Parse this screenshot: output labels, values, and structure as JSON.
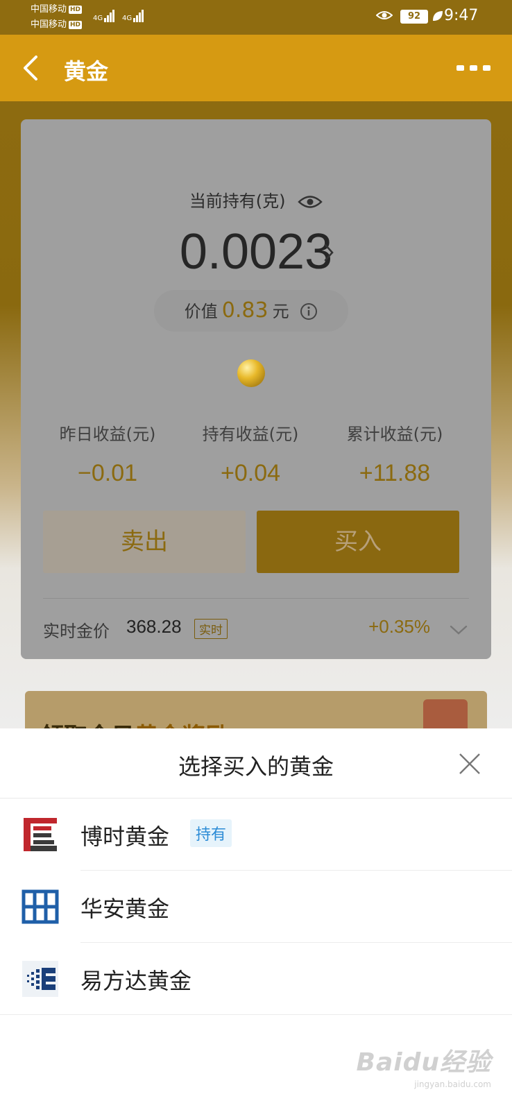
{
  "status_bar": {
    "carrier1": "中国移动",
    "carrier2": "中国移动",
    "hd": "HD",
    "network1": "4G",
    "network2": "4G",
    "battery": "92",
    "time": "9:47"
  },
  "nav": {
    "title": "黄金"
  },
  "card": {
    "hold_label": "当前持有(克)",
    "hold_amount": "0.0023",
    "value_label": "价值",
    "value_amount": "0.83",
    "value_unit": "元",
    "stats": [
      {
        "label": "昨日收益(元)",
        "value": "−0.01"
      },
      {
        "label": "持有收益(元)",
        "value": "+0.04"
      },
      {
        "label": "累计收益(元)",
        "value": "+11.88"
      }
    ],
    "sell_label": "卖出",
    "buy_label": "买入",
    "price_label": "实时金价",
    "price_value": "368.28",
    "live_badge": "实时",
    "change_pct": "+0.35%"
  },
  "promo": {
    "text_prefix": "领取今日",
    "text_highlight": "黄金奖励"
  },
  "sheet": {
    "title": "选择买入的黄金",
    "funds": [
      {
        "name": "博时黄金",
        "badge": "持有",
        "logo": "boshi-logo"
      },
      {
        "name": "华安黄金",
        "badge": "",
        "logo": "huaan-logo"
      },
      {
        "name": "易方达黄金",
        "badge": "",
        "logo": "efund-logo"
      }
    ]
  },
  "watermark": {
    "logo": "Baidu经验",
    "url": "jingyan.baidu.com"
  },
  "colors": {
    "nav_bg": "#d69a12",
    "accent": "#8b6a10",
    "hold_badge_text": "#2b8bd6"
  }
}
